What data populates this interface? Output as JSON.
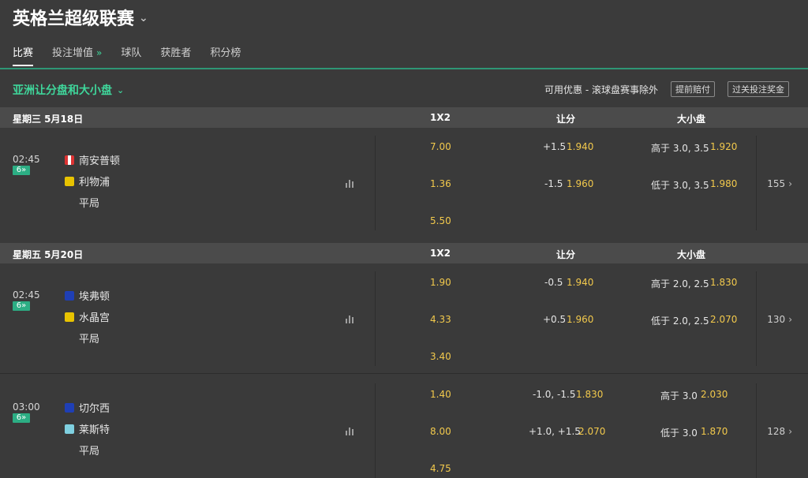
{
  "league": {
    "title": "英格兰超级联赛"
  },
  "tabs": [
    {
      "label": "比赛",
      "active": true
    },
    {
      "label": "投注增值",
      "active": false
    },
    {
      "label": "球队",
      "active": false
    },
    {
      "label": "获胜者",
      "active": false
    },
    {
      "label": "积分榜",
      "active": false
    }
  ],
  "market": {
    "title": "亚洲让分盘和大小盘",
    "promo": "可用优惠 - 滚球盘赛事除外",
    "btn_early": "提前赔付",
    "btn_parlay": "过关投注奖金"
  },
  "headers": {
    "x12": "1X2",
    "spread": "让分",
    "total": "大小盘"
  },
  "dates": [
    "星期三 5月18日",
    "星期五 5月20日"
  ],
  "matches": [
    {
      "time": "02:45",
      "badge": "6",
      "home": "南安普顿",
      "away": "利物浦",
      "draw": "平局",
      "x12": [
        "7.00",
        "1.36",
        "5.50"
      ],
      "spread": [
        {
          "line": "+1.5",
          "odd": "1.940"
        },
        {
          "line": "-1.5",
          "odd": "1.960"
        }
      ],
      "total": [
        {
          "line": "高于 3.0, 3.5",
          "odd": "1.920"
        },
        {
          "line": "低于 3.0, 3.5",
          "odd": "1.980"
        }
      ],
      "more": "155"
    },
    {
      "time": "02:45",
      "badge": "6",
      "home": "埃弗顿",
      "away": "水晶宫",
      "draw": "平局",
      "x12": [
        "1.90",
        "4.33",
        "3.40"
      ],
      "spread": [
        {
          "line": "-0.5",
          "odd": "1.940"
        },
        {
          "line": "+0.5",
          "odd": "1.960"
        }
      ],
      "total": [
        {
          "line": "高于 2.0, 2.5",
          "odd": "1.830"
        },
        {
          "line": "低于 2.0, 2.5",
          "odd": "2.070"
        }
      ],
      "more": "130"
    },
    {
      "time": "03:00",
      "badge": "6",
      "home": "切尔西",
      "away": "莱斯特",
      "draw": "平局",
      "x12": [
        "1.40",
        "8.00",
        "4.75"
      ],
      "spread": [
        {
          "line": "-1.0, -1.5",
          "odd": "1.830"
        },
        {
          "line": "+1.0, +1.5",
          "odd": "2.070"
        }
      ],
      "total": [
        {
          "line": "高于 3.0",
          "odd": "2.030"
        },
        {
          "line": "低于 3.0",
          "odd": "1.870"
        }
      ],
      "more": "128"
    }
  ],
  "colors": {
    "accent": "#2cae84",
    "odds": "#f2c94c",
    "bg": "#3a3a3a",
    "dateBar": "#4b4b4b"
  }
}
